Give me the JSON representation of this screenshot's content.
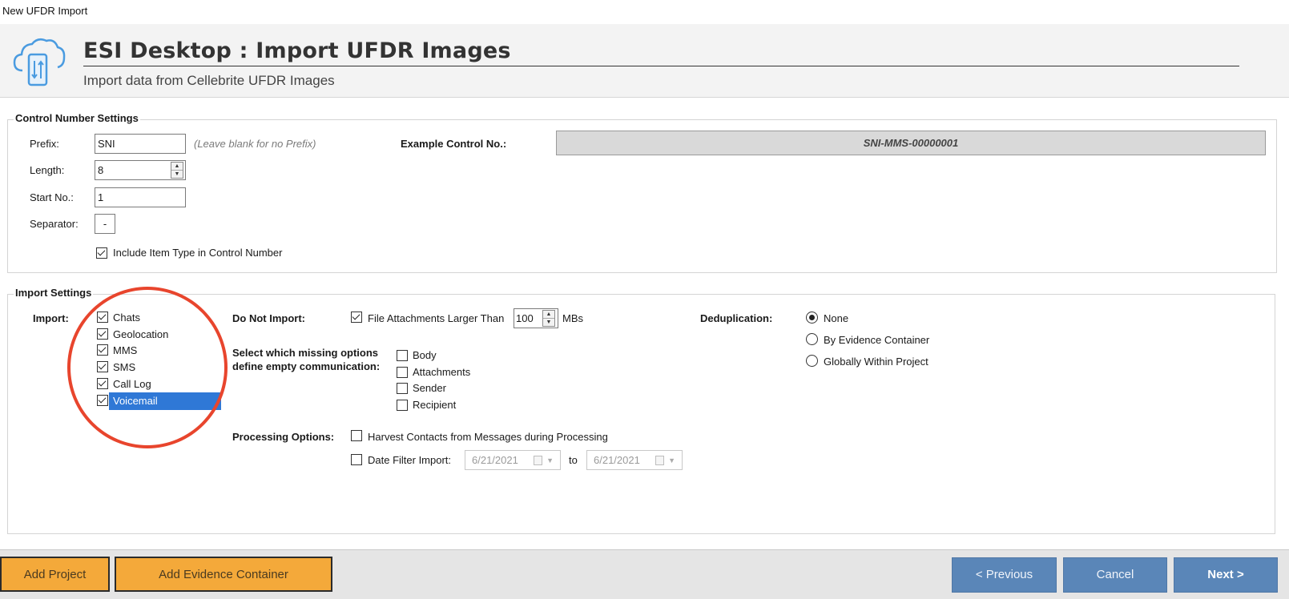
{
  "window": {
    "title": "New UFDR Import"
  },
  "header": {
    "title": "ESI Desktop : Import UFDR Images",
    "subtitle": "Import data from Cellebrite UFDR Images",
    "icon": "cloud-phone-sync-icon"
  },
  "control_number": {
    "group_title": "Control Number Settings",
    "prefix_label": "Prefix:",
    "prefix_value": "SNI",
    "prefix_hint": "(Leave blank for no Prefix)",
    "length_label": "Length:",
    "length_value": "8",
    "start_label": "Start No.:",
    "start_value": "1",
    "separator_label": "Separator:",
    "separator_value": "-",
    "include_item_type_label": "Include Item Type in Control Number",
    "include_item_type_checked": true,
    "example_label": "Example Control No.:",
    "example_value": "SNI-MMS-00000001"
  },
  "import_settings": {
    "group_title": "Import Settings",
    "import_label": "Import:",
    "items": [
      {
        "label": "Chats",
        "checked": true
      },
      {
        "label": "Geolocation",
        "checked": true
      },
      {
        "label": "MMS",
        "checked": true
      },
      {
        "label": "SMS",
        "checked": true
      },
      {
        "label": "Call Log",
        "checked": true
      },
      {
        "label": "Voicemail",
        "checked": true,
        "selected": true
      }
    ],
    "do_not_import_label": "Do Not Import:",
    "file_attach_label": "File Attachments Larger Than",
    "file_attach_checked": true,
    "file_attach_value": "100",
    "file_attach_unit": "MBs",
    "missing_options_label_line1": "Select which missing options",
    "missing_options_label_line2": "define empty communication:",
    "missing_options": [
      {
        "label": "Body",
        "checked": false
      },
      {
        "label": "Attachments",
        "checked": false
      },
      {
        "label": "Sender",
        "checked": false
      },
      {
        "label": "Recipient",
        "checked": false
      }
    ],
    "processing_label": "Processing Options:",
    "harvest_label": "Harvest Contacts from Messages during Processing",
    "harvest_checked": false,
    "date_filter_label": "Date Filter Import:",
    "date_filter_checked": false,
    "date_from": "6/21/2021",
    "date_to_label": "to",
    "date_to": "6/21/2021",
    "dedup_label": "Deduplication:",
    "dedup_options": [
      {
        "label": "None",
        "selected": true
      },
      {
        "label": "By Evidence Container",
        "selected": false
      },
      {
        "label": "Globally Within Project",
        "selected": false
      }
    ]
  },
  "footer": {
    "add_project": "Add Project",
    "add_evidence": "Add Evidence Container",
    "previous": "< Previous",
    "cancel": "Cancel",
    "next": "Next >"
  },
  "colors": {
    "accent_orange": "#f4a93a",
    "button_blue": "#5a86b8",
    "highlight_circle": "#e8452d",
    "selection_blue": "#2f78d6"
  }
}
